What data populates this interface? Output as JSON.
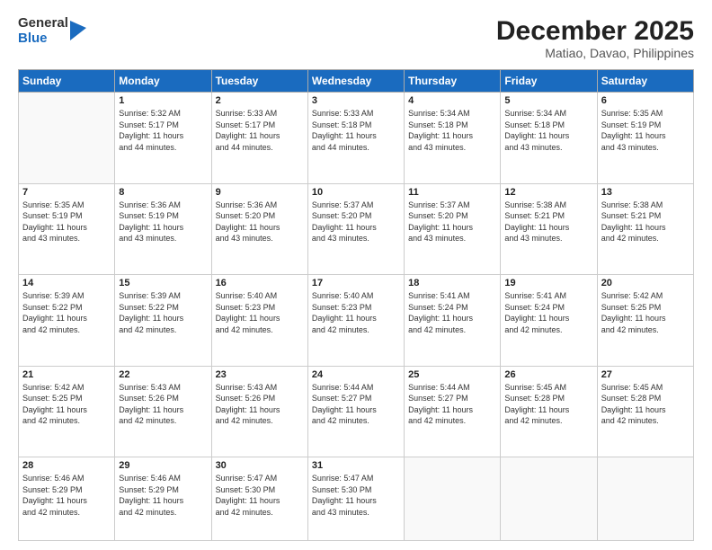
{
  "logo": {
    "general": "General",
    "blue": "Blue"
  },
  "header": {
    "month": "December 2025",
    "location": "Matiao, Davao, Philippines"
  },
  "weekdays": [
    "Sunday",
    "Monday",
    "Tuesday",
    "Wednesday",
    "Thursday",
    "Friday",
    "Saturday"
  ],
  "weeks": [
    [
      {
        "day": "",
        "info": ""
      },
      {
        "day": "1",
        "info": "Sunrise: 5:32 AM\nSunset: 5:17 PM\nDaylight: 11 hours\nand 44 minutes."
      },
      {
        "day": "2",
        "info": "Sunrise: 5:33 AM\nSunset: 5:17 PM\nDaylight: 11 hours\nand 44 minutes."
      },
      {
        "day": "3",
        "info": "Sunrise: 5:33 AM\nSunset: 5:18 PM\nDaylight: 11 hours\nand 44 minutes."
      },
      {
        "day": "4",
        "info": "Sunrise: 5:34 AM\nSunset: 5:18 PM\nDaylight: 11 hours\nand 43 minutes."
      },
      {
        "day": "5",
        "info": "Sunrise: 5:34 AM\nSunset: 5:18 PM\nDaylight: 11 hours\nand 43 minutes."
      },
      {
        "day": "6",
        "info": "Sunrise: 5:35 AM\nSunset: 5:19 PM\nDaylight: 11 hours\nand 43 minutes."
      }
    ],
    [
      {
        "day": "7",
        "info": "Sunrise: 5:35 AM\nSunset: 5:19 PM\nDaylight: 11 hours\nand 43 minutes."
      },
      {
        "day": "8",
        "info": "Sunrise: 5:36 AM\nSunset: 5:19 PM\nDaylight: 11 hours\nand 43 minutes."
      },
      {
        "day": "9",
        "info": "Sunrise: 5:36 AM\nSunset: 5:20 PM\nDaylight: 11 hours\nand 43 minutes."
      },
      {
        "day": "10",
        "info": "Sunrise: 5:37 AM\nSunset: 5:20 PM\nDaylight: 11 hours\nand 43 minutes."
      },
      {
        "day": "11",
        "info": "Sunrise: 5:37 AM\nSunset: 5:20 PM\nDaylight: 11 hours\nand 43 minutes."
      },
      {
        "day": "12",
        "info": "Sunrise: 5:38 AM\nSunset: 5:21 PM\nDaylight: 11 hours\nand 43 minutes."
      },
      {
        "day": "13",
        "info": "Sunrise: 5:38 AM\nSunset: 5:21 PM\nDaylight: 11 hours\nand 42 minutes."
      }
    ],
    [
      {
        "day": "14",
        "info": "Sunrise: 5:39 AM\nSunset: 5:22 PM\nDaylight: 11 hours\nand 42 minutes."
      },
      {
        "day": "15",
        "info": "Sunrise: 5:39 AM\nSunset: 5:22 PM\nDaylight: 11 hours\nand 42 minutes."
      },
      {
        "day": "16",
        "info": "Sunrise: 5:40 AM\nSunset: 5:23 PM\nDaylight: 11 hours\nand 42 minutes."
      },
      {
        "day": "17",
        "info": "Sunrise: 5:40 AM\nSunset: 5:23 PM\nDaylight: 11 hours\nand 42 minutes."
      },
      {
        "day": "18",
        "info": "Sunrise: 5:41 AM\nSunset: 5:24 PM\nDaylight: 11 hours\nand 42 minutes."
      },
      {
        "day": "19",
        "info": "Sunrise: 5:41 AM\nSunset: 5:24 PM\nDaylight: 11 hours\nand 42 minutes."
      },
      {
        "day": "20",
        "info": "Sunrise: 5:42 AM\nSunset: 5:25 PM\nDaylight: 11 hours\nand 42 minutes."
      }
    ],
    [
      {
        "day": "21",
        "info": "Sunrise: 5:42 AM\nSunset: 5:25 PM\nDaylight: 11 hours\nand 42 minutes."
      },
      {
        "day": "22",
        "info": "Sunrise: 5:43 AM\nSunset: 5:26 PM\nDaylight: 11 hours\nand 42 minutes."
      },
      {
        "day": "23",
        "info": "Sunrise: 5:43 AM\nSunset: 5:26 PM\nDaylight: 11 hours\nand 42 minutes."
      },
      {
        "day": "24",
        "info": "Sunrise: 5:44 AM\nSunset: 5:27 PM\nDaylight: 11 hours\nand 42 minutes."
      },
      {
        "day": "25",
        "info": "Sunrise: 5:44 AM\nSunset: 5:27 PM\nDaylight: 11 hours\nand 42 minutes."
      },
      {
        "day": "26",
        "info": "Sunrise: 5:45 AM\nSunset: 5:28 PM\nDaylight: 11 hours\nand 42 minutes."
      },
      {
        "day": "27",
        "info": "Sunrise: 5:45 AM\nSunset: 5:28 PM\nDaylight: 11 hours\nand 42 minutes."
      }
    ],
    [
      {
        "day": "28",
        "info": "Sunrise: 5:46 AM\nSunset: 5:29 PM\nDaylight: 11 hours\nand 42 minutes."
      },
      {
        "day": "29",
        "info": "Sunrise: 5:46 AM\nSunset: 5:29 PM\nDaylight: 11 hours\nand 42 minutes."
      },
      {
        "day": "30",
        "info": "Sunrise: 5:47 AM\nSunset: 5:30 PM\nDaylight: 11 hours\nand 42 minutes."
      },
      {
        "day": "31",
        "info": "Sunrise: 5:47 AM\nSunset: 5:30 PM\nDaylight: 11 hours\nand 43 minutes."
      },
      {
        "day": "",
        "info": ""
      },
      {
        "day": "",
        "info": ""
      },
      {
        "day": "",
        "info": ""
      }
    ]
  ]
}
